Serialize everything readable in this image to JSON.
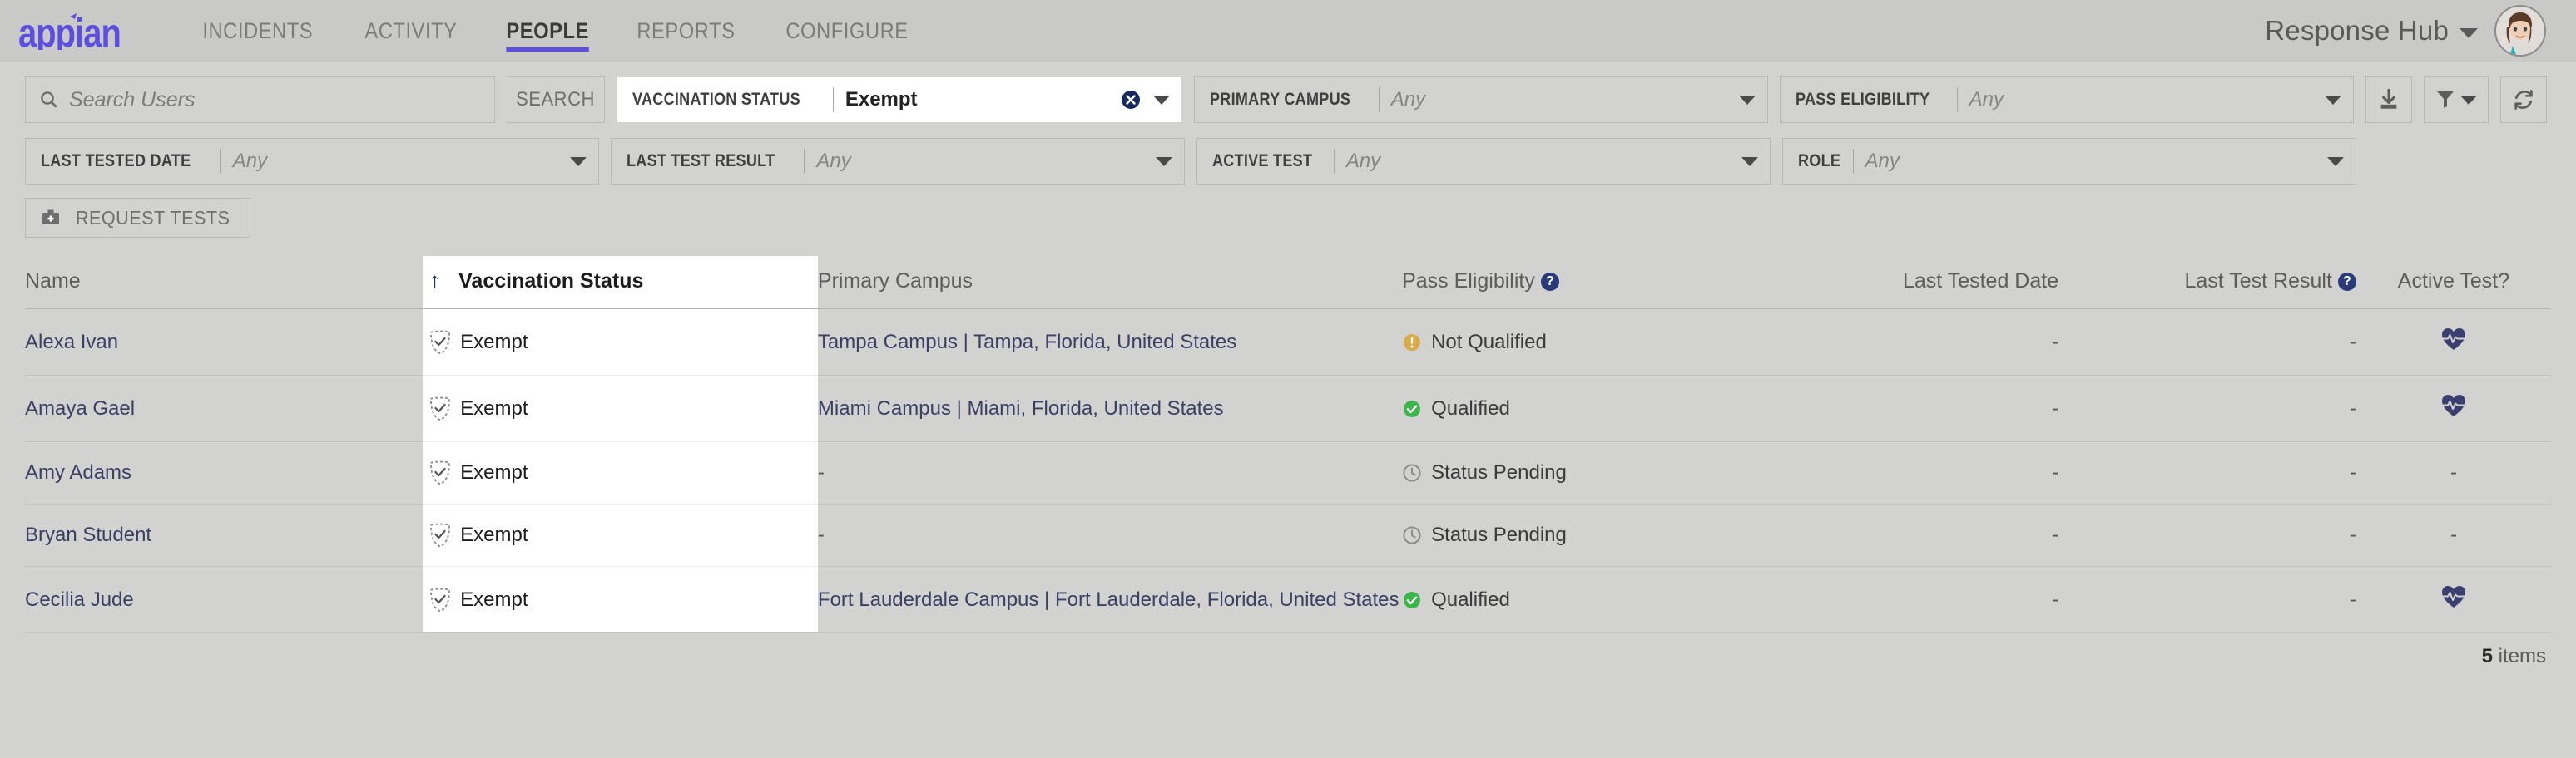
{
  "header": {
    "logo_text": "appian",
    "nav": [
      {
        "label": "INCIDENTS",
        "active": false
      },
      {
        "label": "ACTIVITY",
        "active": false
      },
      {
        "label": "PEOPLE",
        "active": true
      },
      {
        "label": "REPORTS",
        "active": false
      },
      {
        "label": "CONFIGURE",
        "active": false
      }
    ],
    "hub_name": "Response Hub"
  },
  "search": {
    "placeholder": "Search Users",
    "value": "",
    "button_label": "SEARCH"
  },
  "filters": [
    {
      "label": "VACCINATION STATUS",
      "value": "Exempt",
      "active": true,
      "clearable": true
    },
    {
      "label": "PRIMARY CAMPUS",
      "value": "Any",
      "active": false,
      "clearable": false
    },
    {
      "label": "PASS ELIGIBILITY",
      "value": "Any",
      "active": false,
      "clearable": false
    },
    {
      "label": "LAST TESTED DATE",
      "value": "Any",
      "active": false,
      "clearable": false
    },
    {
      "label": "LAST TEST RESULT",
      "value": "Any",
      "active": false,
      "clearable": false
    },
    {
      "label": "ACTIVE TEST",
      "value": "Any",
      "active": false,
      "clearable": false
    },
    {
      "label": "ROLE",
      "value": "Any",
      "active": false,
      "clearable": false
    }
  ],
  "toolbar": {
    "export_icon": "download-icon",
    "filter_icon": "funnel-icon",
    "refresh_icon": "refresh-icon"
  },
  "actions": {
    "request_tests_label": "REQUEST TESTS",
    "request_tests_icon": "medical-kit-icon"
  },
  "table": {
    "sort": {
      "column": "Vaccination Status",
      "direction": "asc",
      "glyph": "↑"
    },
    "columns": [
      {
        "label": "Name",
        "help": false
      },
      {
        "label": "Vaccination Status",
        "help": false
      },
      {
        "label": "Primary Campus",
        "help": false
      },
      {
        "label": "Pass Eligibility",
        "help": true
      },
      {
        "label": "Last Tested Date",
        "help": false
      },
      {
        "label": "Last Test Result",
        "help": true
      },
      {
        "label": "Active Test?",
        "help": false
      }
    ],
    "rows": [
      {
        "name": "Alexa Ivan",
        "vaccination_status": "Exempt",
        "vaccination_icon": "shield-check-dashed-icon",
        "primary_campus": "Tampa Campus | Tampa, Florida, United States",
        "pass_eligibility": "Not Qualified",
        "pass_eligibility_icon": "warning-icon",
        "pass_eligibility_color": "#d9aa4a",
        "last_tested_date": "-",
        "last_test_result": "-",
        "active_test": "heart-pulse-icon"
      },
      {
        "name": "Amaya Gael",
        "vaccination_status": "Exempt",
        "vaccination_icon": "shield-check-dashed-icon",
        "primary_campus": "Miami Campus | Miami, Florida, United States",
        "pass_eligibility": "Qualified",
        "pass_eligibility_icon": "check-circle-icon",
        "pass_eligibility_color": "#3cb54a",
        "last_tested_date": "-",
        "last_test_result": "-",
        "active_test": "heart-pulse-icon"
      },
      {
        "name": "Amy Adams",
        "vaccination_status": "Exempt",
        "vaccination_icon": "shield-check-dashed-icon",
        "primary_campus": "-",
        "pass_eligibility": "Status Pending",
        "pass_eligibility_icon": "clock-icon",
        "pass_eligibility_color": "#8a8a8a",
        "last_tested_date": "-",
        "last_test_result": "-",
        "active_test": "-"
      },
      {
        "name": "Bryan Student",
        "vaccination_status": "Exempt",
        "vaccination_icon": "shield-check-dashed-icon",
        "primary_campus": "-",
        "pass_eligibility": "Status Pending",
        "pass_eligibility_icon": "clock-icon",
        "pass_eligibility_color": "#8a8a8a",
        "last_tested_date": "-",
        "last_test_result": "-",
        "active_test": "-"
      },
      {
        "name": "Cecilia Jude",
        "vaccination_status": "Exempt",
        "vaccination_icon": "shield-check-dashed-icon",
        "primary_campus": "Fort Lauderdale Campus | Fort Lauderdale, Florida, United States",
        "pass_eligibility": "Qualified",
        "pass_eligibility_icon": "check-circle-icon",
        "pass_eligibility_color": "#3cb54a",
        "last_tested_date": "-",
        "last_test_result": "-",
        "active_test": "heart-pulse-icon"
      }
    ]
  },
  "footer": {
    "count": "5",
    "count_label": "items"
  },
  "colors": {
    "accent": "#5c4fe0",
    "page_bg": "#d2d2d0",
    "topbar_bg": "#c9c9c7",
    "link": "#3b3f63",
    "sort_arrow": "#1b2a66",
    "help_badge": "#2b3a7a"
  }
}
